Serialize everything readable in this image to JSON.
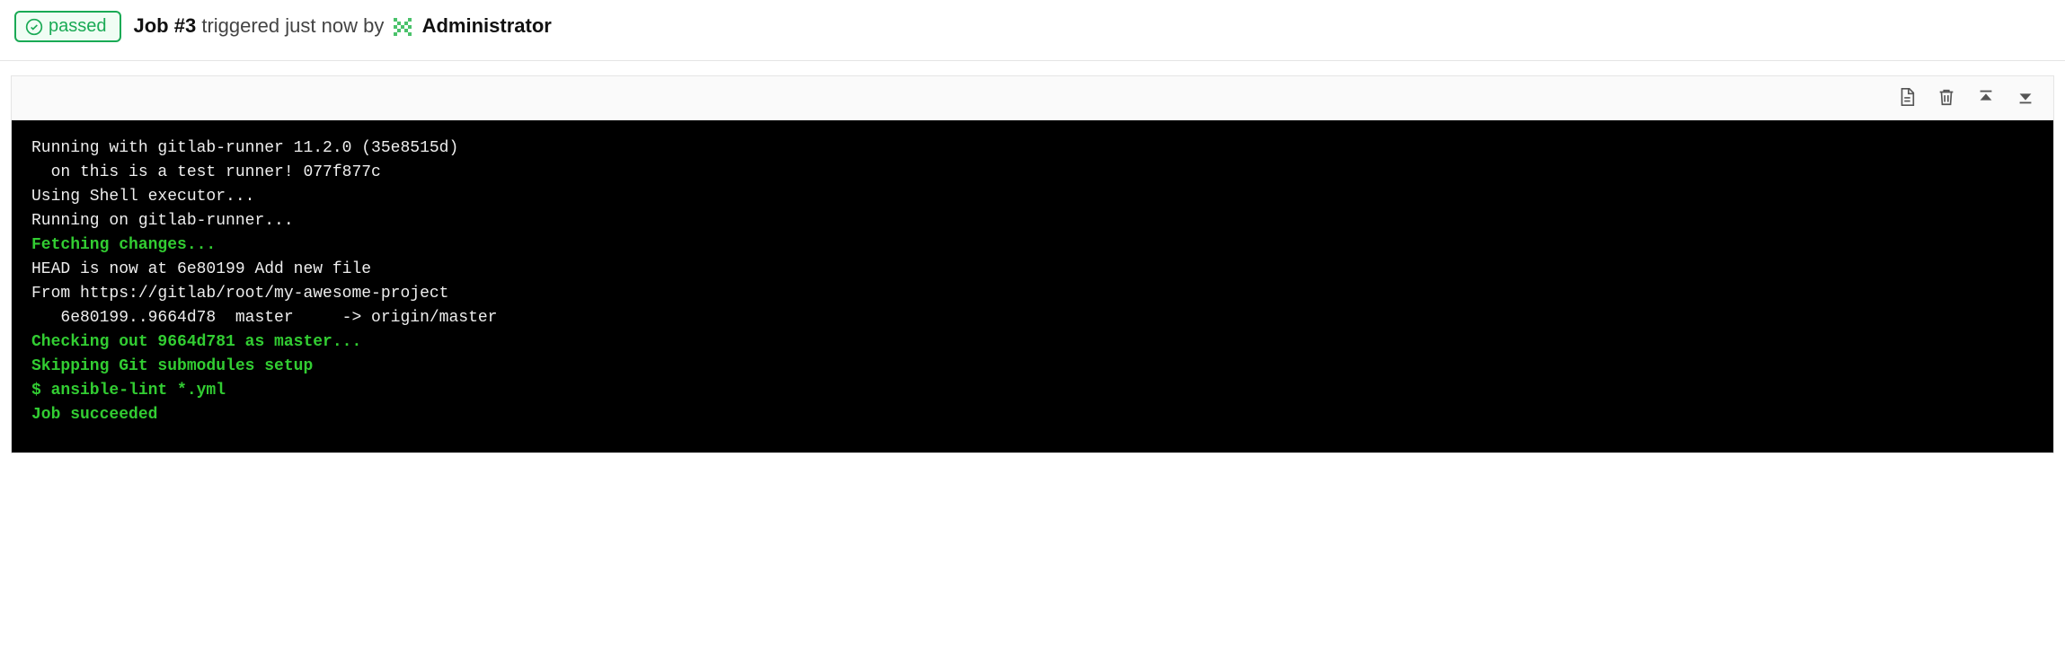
{
  "status": {
    "label": "passed"
  },
  "header": {
    "job_label": "Job #3",
    "triggered_text": "triggered just now by",
    "user": "Administrator"
  },
  "toolbar": {
    "raw_title": "Show complete raw",
    "erase_title": "Erase job log",
    "top_title": "Scroll to top",
    "bottom_title": "Scroll to bottom"
  },
  "log_lines": [
    {
      "text": "Running with gitlab-runner 11.2.0 (35e8515d)",
      "cls": "c-white"
    },
    {
      "text": "  on this is a test runner! 077f877c",
      "cls": "c-white"
    },
    {
      "text": "Using Shell executor...",
      "cls": "c-white"
    },
    {
      "text": "Running on gitlab-runner...",
      "cls": "c-white"
    },
    {
      "text": "Fetching changes...",
      "cls": "c-green"
    },
    {
      "text": "HEAD is now at 6e80199 Add new file",
      "cls": "c-white"
    },
    {
      "text": "From https://gitlab/root/my-awesome-project",
      "cls": "c-white"
    },
    {
      "text": "   6e80199..9664d78  master     -> origin/master",
      "cls": "c-white"
    },
    {
      "text": "Checking out 9664d781 as master...",
      "cls": "c-green"
    },
    {
      "text": "Skipping Git submodules setup",
      "cls": "c-green"
    },
    {
      "text": "$ ansible-lint *.yml",
      "cls": "c-green"
    },
    {
      "text": "Job succeeded",
      "cls": "c-green"
    }
  ]
}
